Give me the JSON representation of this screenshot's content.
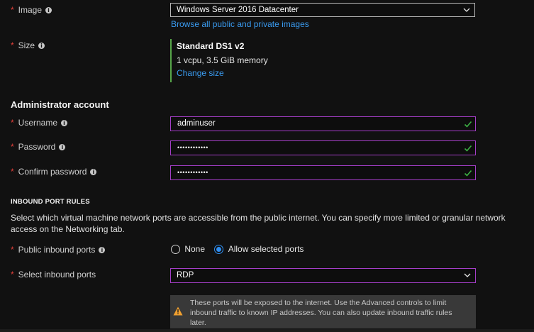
{
  "image": {
    "label": "Image",
    "value": "Windows Server 2016 Datacenter",
    "browse_link": "Browse all public and private images"
  },
  "size": {
    "label": "Size",
    "name": "Standard DS1 v2",
    "detail": "1 vcpu, 3.5 GiB memory",
    "change_link": "Change size"
  },
  "admin": {
    "heading": "Administrator account",
    "username_label": "Username",
    "username_value": "adminuser",
    "password_label": "Password",
    "password_value": "••••••••••••",
    "confirm_label": "Confirm password",
    "confirm_value": "••••••••••••"
  },
  "inbound": {
    "heading": "INBOUND PORT RULES",
    "description": "Select which virtual machine network ports are accessible from the public internet. You can specify more limited or granular network access on the Networking tab.",
    "public_label": "Public inbound ports",
    "option_none": "None",
    "option_allow": "Allow selected ports",
    "selected_option": "Allow selected ports",
    "select_label": "Select inbound ports",
    "select_value": "RDP",
    "warning": "These ports will be exposed to the internet. Use the Advanced controls to limit inbound traffic to known IP addresses. You can also update inbound traffic rules later."
  },
  "colors": {
    "accent": "#a43ec7",
    "link": "#3a9bf0",
    "required": "#e3403a",
    "valid": "#3cb043",
    "size_bar": "#57a64a",
    "warning": "#f0a030"
  },
  "icons": [
    "info-icon",
    "chevron-down-icon",
    "checkmark-icon",
    "warning-icon"
  ]
}
